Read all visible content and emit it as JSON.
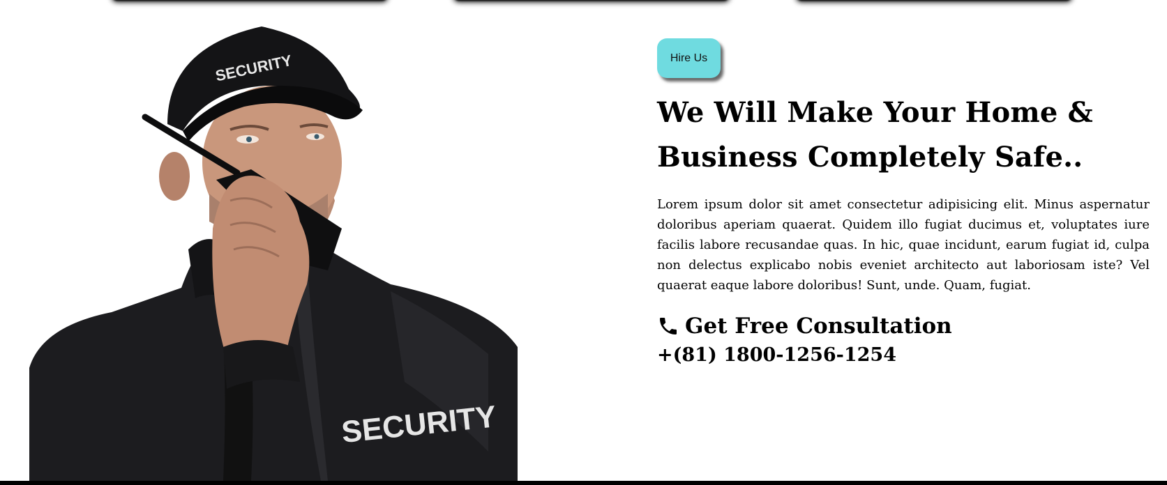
{
  "hero": {
    "cap_text": "SECURITY",
    "jacket_text": "SECURITY"
  },
  "cta": {
    "hire_label": "Hire Us"
  },
  "headline": "We Will Make Your Home & Business Completely Safe..",
  "body": "Lorem ipsum dolor sit amet consectetur adipisicing elit. Minus aspernatur doloribus aperiam quaerat. Quidem illo fugiat ducimus et, voluptates iure facilis labore recusandae quas. In hic, quae incidunt, earum fugiat id, culpa non delectus explicabo nobis eveniet architecto aut laboriosam iste? Vel quaerat eaque labore doloribus! Sunt, unde. Quam, fugiat.",
  "consultation": {
    "icon": "phone-icon",
    "label": "Get Free Consultation",
    "phone": "+(81) 1800-1256-1254"
  },
  "colors": {
    "button_bg": "#6fdbe0",
    "text": "#000000"
  }
}
